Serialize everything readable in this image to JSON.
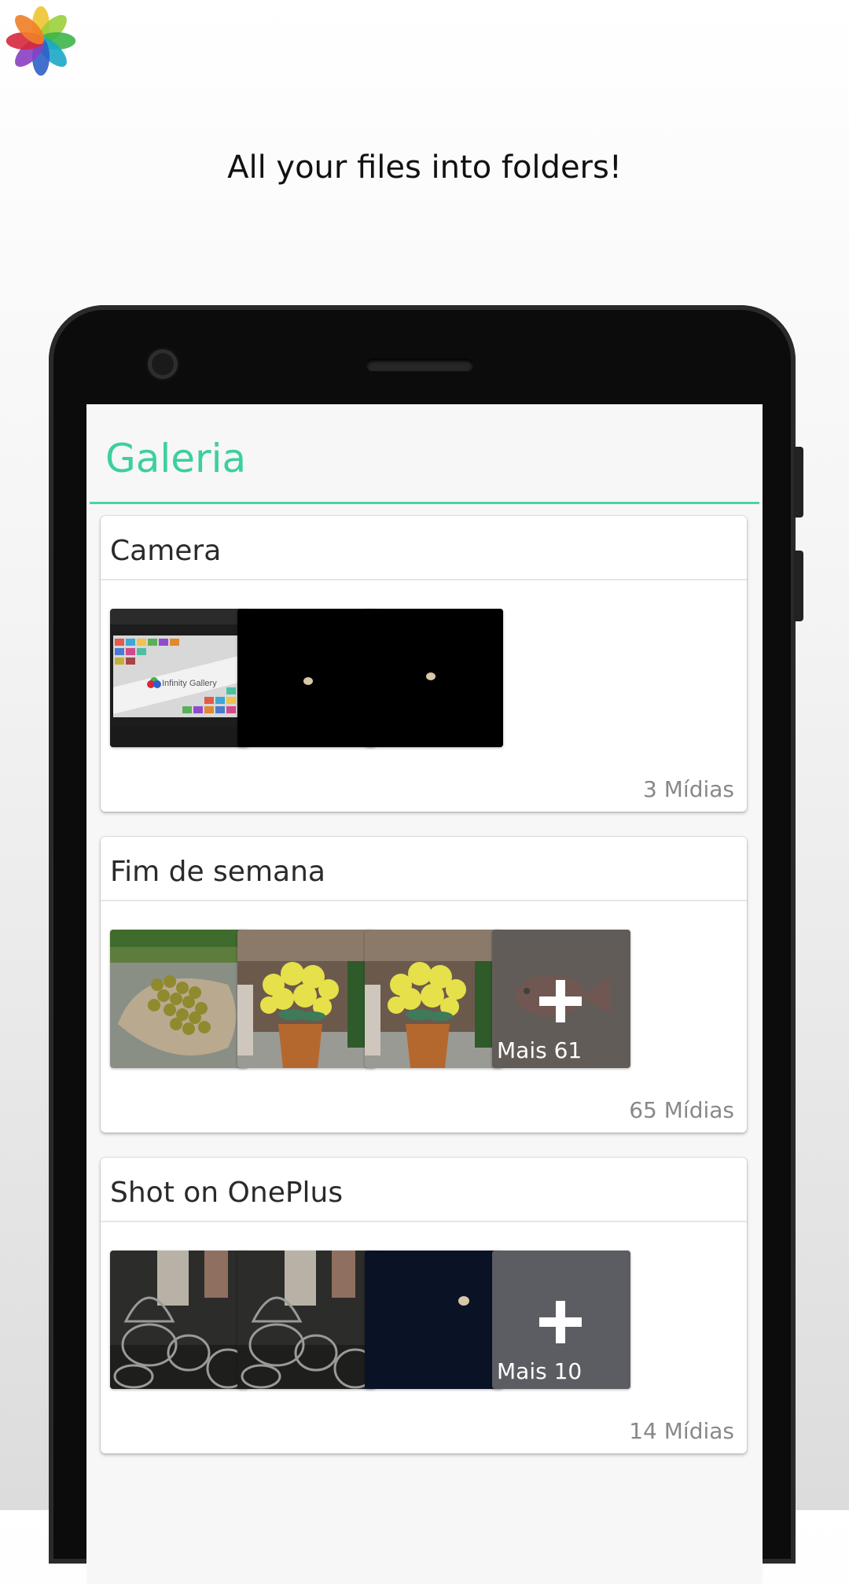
{
  "tagline": "All your files into folders!",
  "app": {
    "title": "Galeria",
    "accent": "#3dcf9e"
  },
  "albums": [
    {
      "name": "Camera",
      "count": "3 Mídias",
      "thumbs": [
        "infinity-gallery-laptop-photo",
        "moon-night-photo",
        "moon-night-photo"
      ]
    },
    {
      "name": "Fim de semana",
      "count": "65 Mídias",
      "thumbs": [
        "berries-on-leaf-photo",
        "yellow-flowers-vase-photo",
        "yellow-flowers-vase-photo"
      ],
      "more": "Mais 61"
    },
    {
      "name": "Shot on OnePlus",
      "count": "14 Mídias",
      "thumbs": [
        "glass-jars-photo",
        "glass-jars-photo",
        "moon-dark-sky-photo"
      ],
      "more": "Mais 10"
    }
  ],
  "laptop_screen_text": "Infinity Gallery"
}
